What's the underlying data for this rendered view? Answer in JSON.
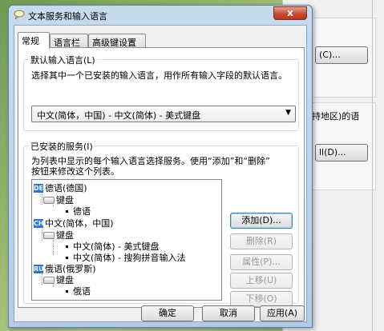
{
  "background_window": {
    "btn1_label": "(C)...",
    "text_region": "持地区)的语",
    "btn2_label": "ll(D)..."
  },
  "dialog": {
    "title": "文本服务和输入语言",
    "close_label": "x",
    "tabs": [
      {
        "label": "常规",
        "active": true
      },
      {
        "label": "语言栏",
        "active": false
      },
      {
        "label": "高级键设置",
        "active": false
      }
    ],
    "default_group": {
      "label": "默认输入语言(L)",
      "description": "选择其中一个已安装的输入语言，用作所有输入字段的默认语言。",
      "selected": "中文(简体，中国) - 中文(简体) - 美式键盘"
    },
    "installed_group": {
      "label": "已安装的服务(I)",
      "description_line1": "为列表中显示的每个输入语言选择服务。使用“添加”和“删除”",
      "description_line2": "按钮来修改这个列表。"
    },
    "tree": {
      "lang1": {
        "badge": "DE",
        "label": "德语(德国)",
        "kbd": "键盘",
        "items": [
          "德语"
        ]
      },
      "lang2": {
        "badge": "CH",
        "label": "中文(简体，中国)",
        "kbd": "键盘",
        "items": [
          "中文(简体) - 美式键盘",
          "中文(简体) - 搜狗拼音输入法"
        ]
      },
      "lang3": {
        "badge": "RU",
        "label": "俄语(俄罗斯)",
        "kbd": "键盘",
        "items": [
          "俄语"
        ]
      }
    },
    "side_buttons": {
      "add": "添加(D)...",
      "remove": "删除(R)",
      "properties": "属性(P)...",
      "move_up": "上移(U)",
      "move_down": "下移(O)"
    },
    "footer": {
      "ok": "确定",
      "cancel": "取消",
      "apply": "应用(A)"
    }
  }
}
